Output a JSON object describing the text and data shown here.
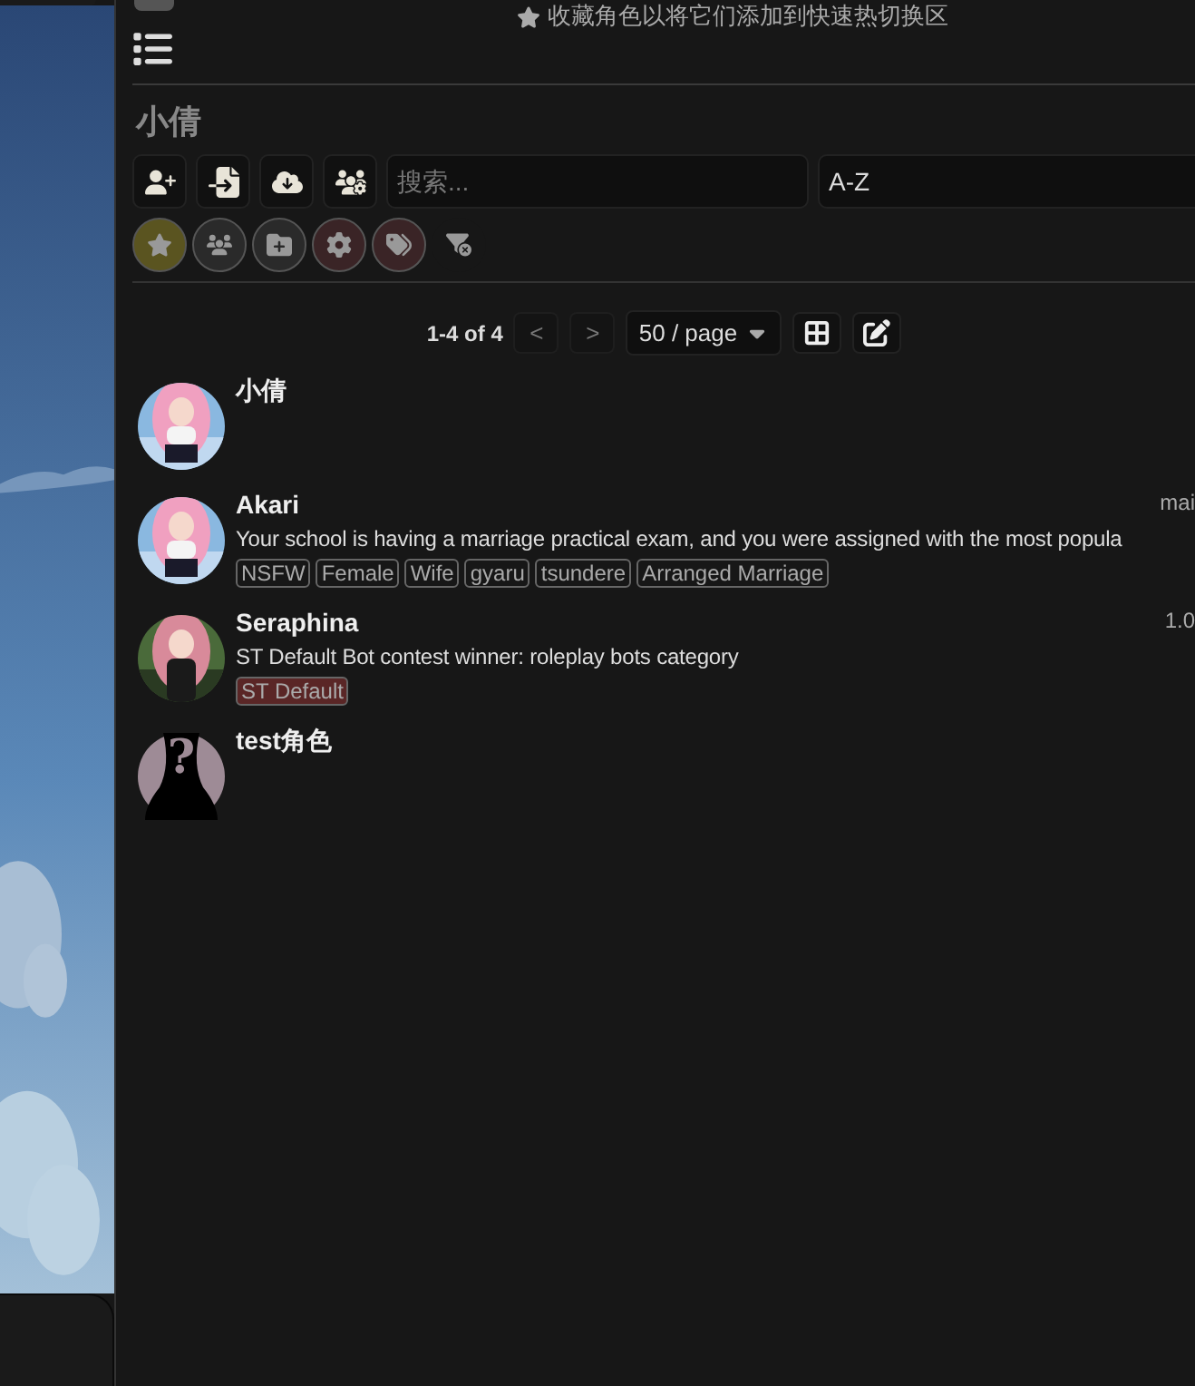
{
  "hint": {
    "text": "收藏角色以将它们添加到快速热切换区"
  },
  "title": "小倩",
  "toolbar": {
    "buttons": [
      {
        "kind": "add-user"
      },
      {
        "kind": "import"
      },
      {
        "kind": "download"
      },
      {
        "kind": "group"
      }
    ],
    "search": {
      "placeholder": "搜索..."
    },
    "sort": {
      "value": "A-Z"
    }
  },
  "filters": [
    {
      "kind": "star",
      "color": "#5a5420"
    },
    {
      "kind": "groups",
      "color": "#2a2a2a"
    },
    {
      "kind": "folder",
      "color": "#2a2a2a"
    },
    {
      "kind": "gear",
      "color": "#3a2426"
    },
    {
      "kind": "tags",
      "color": "#3a2426"
    },
    {
      "kind": "clear",
      "color": "#171717"
    }
  ],
  "pagination": {
    "range": "1-4 of 4",
    "prev": "<",
    "next": ">",
    "page_size": "50 / page"
  },
  "characters": [
    {
      "name": "小倩"
    },
    {
      "name": "Akari",
      "meta": "mai",
      "description": "Your school is having a marriage practical exam, and you were assigned with the most popula",
      "tags": [
        {
          "label": "NSFW",
          "color": "#171717"
        },
        {
          "label": "Female",
          "color": "#171717"
        },
        {
          "label": "Wife",
          "color": "#171717"
        },
        {
          "label": "gyaru",
          "color": "#171717"
        },
        {
          "label": "tsundere",
          "color": "#171717"
        },
        {
          "label": "Arranged Marriage",
          "color": "#171717"
        }
      ]
    },
    {
      "name": "Seraphina",
      "meta": "1.0",
      "description": "ST Default Bot contest winner: roleplay bots category",
      "tags": [
        {
          "label": "ST Default",
          "color": "#5a2626"
        }
      ]
    },
    {
      "name": "test角色",
      "avatar": {
        "kind": "default",
        "glyph": "?"
      }
    }
  ]
}
